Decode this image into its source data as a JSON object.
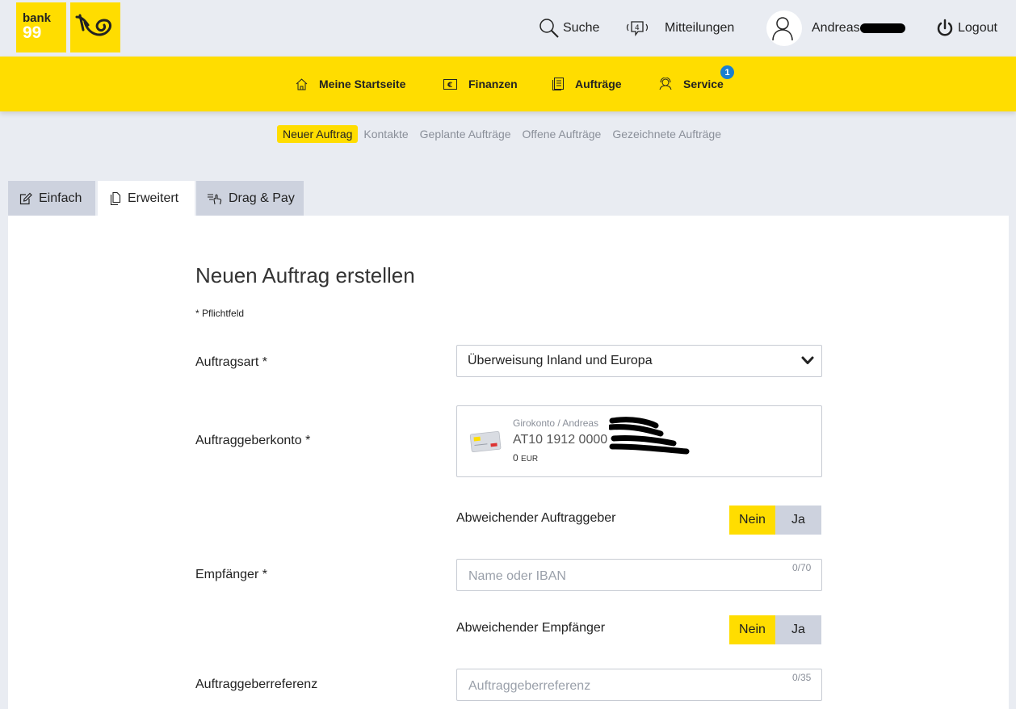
{
  "header": {
    "logo_bank_line1": "bank",
    "logo_bank_line2": "99",
    "search_label": "Suche",
    "messages_label": "Mitteilungen",
    "user_name": "Andreas",
    "logout_label": "Logout"
  },
  "nav": {
    "items": [
      {
        "label": "Meine Startseite",
        "icon": "home-icon"
      },
      {
        "label": "Finanzen",
        "icon": "finance-icon"
      },
      {
        "label": "Aufträge",
        "icon": "orders-icon"
      },
      {
        "label": "Service",
        "icon": "service-icon"
      }
    ],
    "service_badge": "1"
  },
  "subnav": {
    "items": [
      "Neuer Auftrag",
      "Kontakte",
      "Geplante Aufträge",
      "Offene Aufträge",
      "Gezeichnete Aufträge"
    ],
    "active": "Neuer Auftrag"
  },
  "tabs": [
    {
      "label": "Einfach",
      "icon": "edit-icon"
    },
    {
      "label": "Erweitert",
      "icon": "copy-icon"
    },
    {
      "label": "Drag & Pay",
      "icon": "drag-pay-icon"
    }
  ],
  "form": {
    "title": "Neuen Auftrag erstellen",
    "required_note": "* Pflichtfeld",
    "auftragsart_label": "Auftragsart *",
    "auftragsart_value": "Überweisung Inland und Europa",
    "konto_label": "Auftraggeberkonto *",
    "konto_name": "Girokonto / Andreas",
    "konto_iban": "AT10 1912 0000",
    "konto_balance": "0",
    "konto_currency": "EUR",
    "abw_auftraggeber_label": "Abweichender Auftraggeber",
    "empfaenger_label": "Empfänger *",
    "empfaenger_placeholder": "Name oder IBAN",
    "empfaenger_counter": "0/70",
    "abw_empfaenger_label": "Abweichender Empfänger",
    "referenz_label": "Auftraggeberreferenz",
    "referenz_placeholder": "Auftraggeberreferenz",
    "referenz_counter": "0/35",
    "toggle_no": "Nein",
    "toggle_yes": "Ja"
  },
  "colors": {
    "brand_yellow": "#ffdd00",
    "background": "#e9ecf2",
    "tab_inactive": "#cdd2de",
    "badge_blue": "#1a7fd0"
  }
}
